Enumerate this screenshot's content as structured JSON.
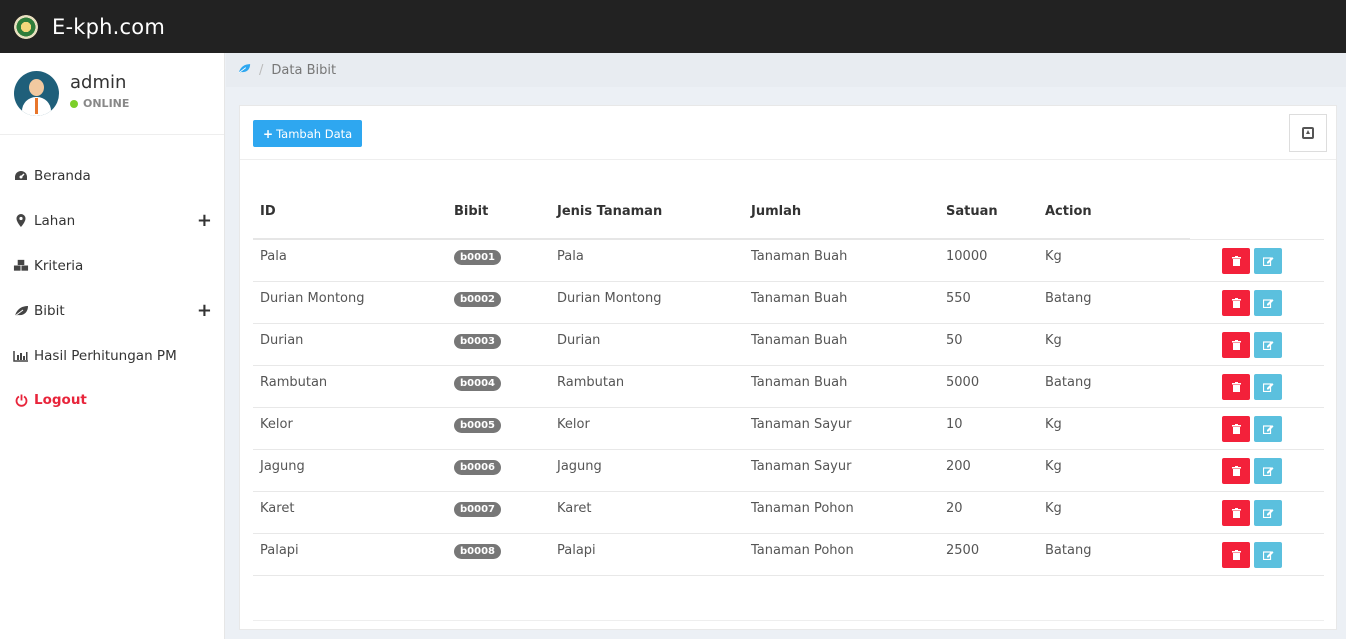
{
  "app": {
    "brand": "E-kph.com"
  },
  "user": {
    "name": "admin",
    "status": "ONLINE"
  },
  "sidebar": {
    "items": [
      {
        "label": "Beranda",
        "icon": "dashboard-icon",
        "has_submenu": false
      },
      {
        "label": "Lahan",
        "icon": "map-marker-icon",
        "has_submenu": true
      },
      {
        "label": "Kriteria",
        "icon": "cubes-icon",
        "has_submenu": false
      },
      {
        "label": "Bibit",
        "icon": "leaf-icon",
        "has_submenu": true
      },
      {
        "label": "Hasil Perhitungan PM",
        "icon": "bar-chart-icon",
        "has_submenu": false
      }
    ],
    "logout": "Logout"
  },
  "breadcrumb": {
    "current": "Data Bibit"
  },
  "toolbar": {
    "add_label": "Tambah Data"
  },
  "table": {
    "headers": [
      "ID",
      "Bibit",
      "Jenis Tanaman",
      "Jumlah",
      "Satuan",
      "Action"
    ],
    "rows": [
      {
        "id": "Pala",
        "bibit": "b0001",
        "jenis": "Pala",
        "jumlah": "Tanaman Buah",
        "satuan": "10000",
        "action": "Kg"
      },
      {
        "id": "Durian Montong",
        "bibit": "b0002",
        "jenis": "Durian Montong",
        "jumlah": "Tanaman Buah",
        "satuan": "550",
        "action": "Batang"
      },
      {
        "id": "Durian",
        "bibit": "b0003",
        "jenis": "Durian",
        "jumlah": "Tanaman Buah",
        "satuan": "50",
        "action": "Kg"
      },
      {
        "id": "Rambutan",
        "bibit": "b0004",
        "jenis": "Rambutan",
        "jumlah": "Tanaman Buah",
        "satuan": "5000",
        "action": "Batang"
      },
      {
        "id": "Kelor",
        "bibit": "b0005",
        "jenis": "Kelor",
        "jumlah": "Tanaman Sayur",
        "satuan": "10",
        "action": "Kg"
      },
      {
        "id": "Jagung",
        "bibit": "b0006",
        "jenis": "Jagung",
        "jumlah": "Tanaman Sayur",
        "satuan": "200",
        "action": "Kg"
      },
      {
        "id": "Karet",
        "bibit": "b0007",
        "jenis": "Karet",
        "jumlah": "Tanaman Pohon",
        "satuan": "20",
        "action": "Kg"
      },
      {
        "id": "Palapi",
        "bibit": "b0008",
        "jenis": "Palapi",
        "jumlah": "Tanaman Pohon",
        "satuan": "2500",
        "action": "Batang"
      }
    ]
  },
  "colors": {
    "topbar": "#222222",
    "primary": "#2ea7f0",
    "danger": "#f3213a",
    "info": "#5bc0de",
    "online": "#7ccf29"
  }
}
